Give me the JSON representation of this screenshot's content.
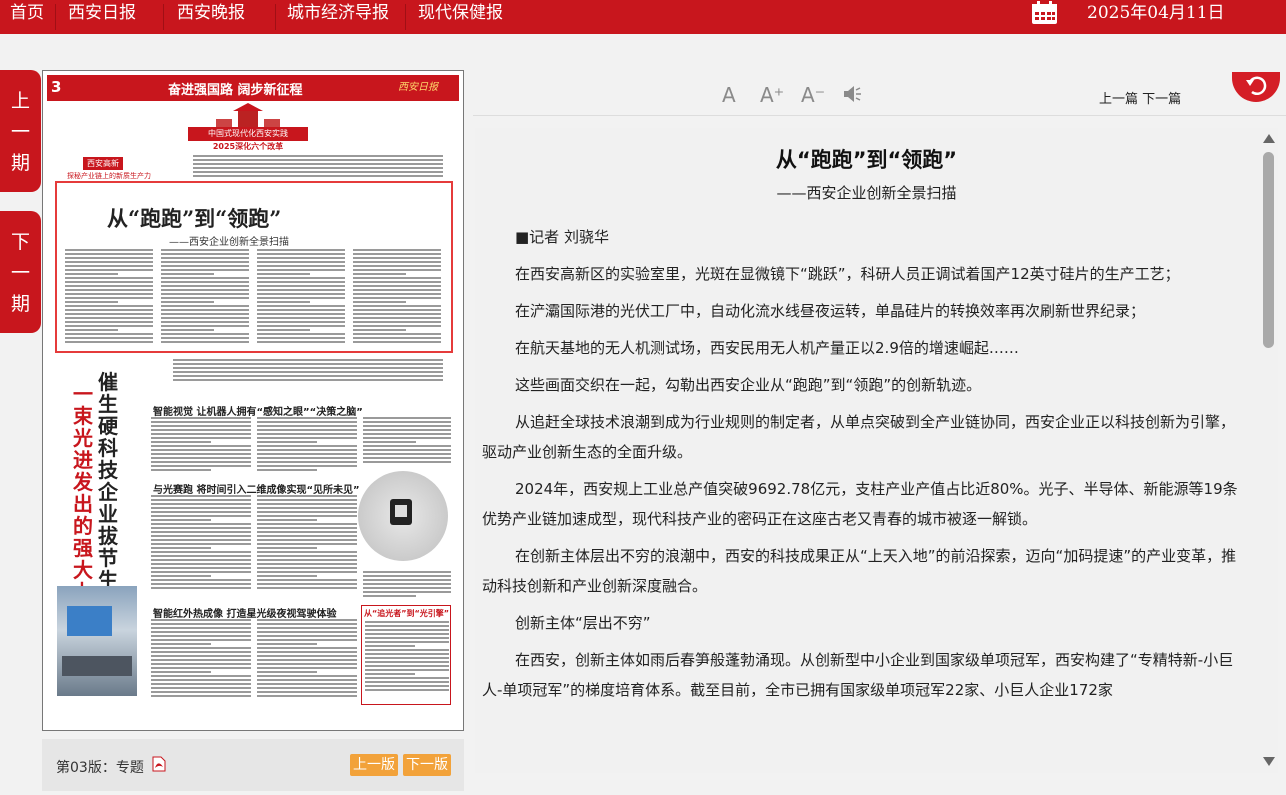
{
  "topnav": {
    "items": [
      "首页",
      "西安日报",
      "西安晚报",
      "城市经济导报",
      "现代保健报"
    ],
    "date": "2025年04月11日"
  },
  "issue_tabs": {
    "prev": [
      "上",
      "一",
      "期"
    ],
    "next": [
      "下",
      "一",
      "期"
    ]
  },
  "page_image": {
    "page_number": "3",
    "header_title": "奋进强国路 阔步新征程",
    "brand": "西安日报",
    "banner_top": "中国式现代化西安实践",
    "banner_bottom": "2025深化六个改革",
    "side_label": "西安高新",
    "side_sub": "探秘产业链上的新质生产力",
    "boxed_title": "从“跑跑”到“领跑”",
    "boxed_subtitle": "——西安企业创新全景扫描",
    "vertical_headline_1": "一束光进发出的强大力量",
    "vertical_headline_2": "催生硬科技企业拔节生长",
    "section_1": "智能视觉 让机器人拥有“感知之眼”“决策之脑”",
    "section_2": "与光赛跑 将时间引入二维成像实现“见所未见”",
    "section_3": "智能红外热成像 打造星光级夜视驾驶体验",
    "quote_title": "从“追光者”到“光引擎”"
  },
  "page_footer": {
    "edition": "第03版：专题",
    "prev_page": "上一版",
    "next_page": "下一版"
  },
  "toolbar": {
    "font_default": "A",
    "font_increase": "A⁺",
    "font_decrease": "A⁻",
    "prev_article": "上一篇",
    "next_article": "下一篇"
  },
  "article": {
    "title": "从“跑跑”到“领跑”",
    "subtitle": "——西安企业创新全景扫描",
    "paragraphs": [
      "■记者 刘骁华",
      "在西安高新区的实验室里，光斑在显微镜下“跳跃”，科研人员正调试着国产12英寸硅片的生产工艺；",
      "在浐灞国际港的光伏工厂中，自动化流水线昼夜运转，单晶硅片的转换效率再次刷新世界纪录；",
      "在航天基地的无人机测试场，西安民用无人机产量正以2.9倍的增速崛起……",
      "这些画面交织在一起，勾勒出西安企业从“跑跑”到“领跑”的创新轨迹。",
      "从追赶全球技术浪潮到成为行业规则的制定者，从单点突破到全产业链协同，西安企业正以科技创新为引擎，驱动产业创新生态的全面升级。",
      "2024年，西安规上工业总产值突破9692.78亿元，支柱产业产值占比近80%。光子、半导体、新能源等19条优势产业链加速成型，现代科技产业的密码正在这座古老又青春的城市被逐一解锁。",
      "在创新主体层出不穷的浪潮中，西安的科技成果正从“上天入地”的前沿探索，迈向“加码提速”的产业变革，推动科技创新和产业创新深度融合。",
      "创新主体“层出不穷”",
      "在西安，创新主体如雨后春笋般蓬勃涌现。从创新型中小企业到国家级单项冠军，西安构建了“专精特新-小巨人-单项冠军”的梯度培育体系。截至目前，全市已拥有国家级单项冠军22家、小巨人企业172家"
    ]
  },
  "colors": {
    "brand_red": "#c8161d",
    "page_button": "#f2a23a",
    "article_bg": "#f1f1f1"
  }
}
